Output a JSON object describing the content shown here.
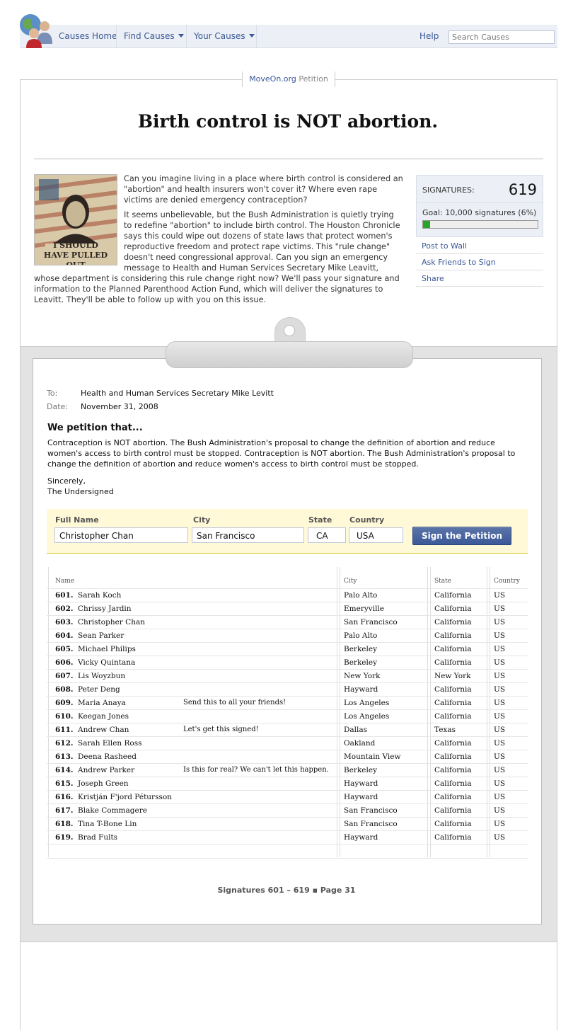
{
  "nav": {
    "causes_home": "Causes Home",
    "find_causes": "Find Causes",
    "your_causes": "Your Causes",
    "help": "Help",
    "search_placeholder": "Search Causes"
  },
  "petition": {
    "org": "MoveOn.org",
    "tab_suffix": "Petition",
    "title": "Birth control is NOT abortion.",
    "poster_text": "I SHOULD HAVE PULLED OUT",
    "paragraph1": "Can you imagine living in a place where birth control is considered an \"abortion\" and health insurers won't cover it? Where even rape victims are denied emergency contraception?",
    "paragraph2": "It seems unbelievable, but the Bush Administration is quietly trying to redefine \"abortion\" to include birth control. The Houston Chronicle says this could wipe out dozens of state laws that protect women's reproductive freedom and protect rape victims. This \"rule change\" doesn't need congressional approval. Can you sign an emergency message to Health and Human Services Secretary Mike Leavitt, whose department is considering this rule change right now? We'll pass your signature and information to the Planned Parenthood Action Fund, which will deliver the signatures to Leavitt. They'll be able to follow up with you on this issue."
  },
  "signatures": {
    "label": "SIGNATURES:",
    "count": "619",
    "goal_text": "Goal: 10,000 signatures (6%)",
    "progress": 0.06
  },
  "actions": {
    "post_to_wall": "Post to Wall",
    "ask_friends": "Ask Friends to Sign",
    "share": "Share"
  },
  "letter": {
    "to_label": "To:",
    "to": "Health and Human Services Secretary Mike Levitt",
    "date_label": "Date:",
    "date": "November 31, 2008",
    "heading": "We petition that...",
    "body": "Contraception is NOT abortion. The Bush Administration's proposal to change the definition of abortion and reduce women's access to birth control must be stopped. Contraception is NOT abortion. The Bush Administration's proposal to change the definition of abortion and reduce women's access to birth control must be stopped.",
    "closing1": "Sincerely,",
    "closing2": "The Undersigned"
  },
  "form": {
    "full_name_label": "Full Name",
    "city_label": "City",
    "state_label": "State",
    "country_label": "Country",
    "full_name": "Christopher Chan",
    "city": "San Francisco",
    "state": "CA",
    "country": "USA",
    "submit": "Sign the Petition"
  },
  "table": {
    "headers": {
      "name": "Name",
      "city": "City",
      "state": "State",
      "country": "Country"
    },
    "rows": [
      {
        "num": "601.",
        "name": "Sarah Koch",
        "comment": "",
        "city": "Palo Alto",
        "state": "California",
        "country": "US"
      },
      {
        "num": "602.",
        "name": "Chrissy Jardin",
        "comment": "",
        "city": "Emeryville",
        "state": "California",
        "country": "US"
      },
      {
        "num": "603.",
        "name": "Christopher Chan",
        "comment": "",
        "city": "San Francisco",
        "state": "California",
        "country": "US"
      },
      {
        "num": "604.",
        "name": "Sean Parker",
        "comment": "",
        "city": "Palo Alto",
        "state": "California",
        "country": "US"
      },
      {
        "num": "605.",
        "name": "Michael Philips",
        "comment": "",
        "city": "Berkeley",
        "state": "California",
        "country": "US"
      },
      {
        "num": "606.",
        "name": "Vicky Quintana",
        "comment": "",
        "city": "Berkeley",
        "state": "California",
        "country": "US"
      },
      {
        "num": "607.",
        "name": "Lis Woyzbun",
        "comment": "",
        "city": "New York",
        "state": "New York",
        "country": "US"
      },
      {
        "num": "608.",
        "name": "Peter Deng",
        "comment": "",
        "city": "Hayward",
        "state": "California",
        "country": "US"
      },
      {
        "num": "609.",
        "name": "Maria Anaya",
        "comment": "Send this to all your friends!",
        "city": "Los Angeles",
        "state": "California",
        "country": "US"
      },
      {
        "num": "610.",
        "name": "Keegan Jones",
        "comment": "",
        "city": "Los Angeles",
        "state": "California",
        "country": "US"
      },
      {
        "num": "611.",
        "name": "Andrew Chan",
        "comment": "Let's get this signed!",
        "city": "Dallas",
        "state": "Texas",
        "country": "US"
      },
      {
        "num": "612.",
        "name": "Sarah Ellen Ross",
        "comment": "",
        "city": "Oakland",
        "state": "California",
        "country": "US"
      },
      {
        "num": "613.",
        "name": "Deena Rasheed",
        "comment": "",
        "city": "Mountain View",
        "state": "California",
        "country": "US"
      },
      {
        "num": "614.",
        "name": "Andrew Parker",
        "comment": "Is this for real? We can't let this happen.",
        "city": "Berkeley",
        "state": "California",
        "country": "US"
      },
      {
        "num": "615.",
        "name": "Joseph Green",
        "comment": "",
        "city": "Hayward",
        "state": "California",
        "country": "US"
      },
      {
        "num": "616.",
        "name": "Kristján F'jord Pétursson",
        "comment": "",
        "city": "Hayward",
        "state": "California",
        "country": "US"
      },
      {
        "num": "617.",
        "name": "Blake Commagere",
        "comment": "",
        "city": "San Francisco",
        "state": "California",
        "country": "US"
      },
      {
        "num": "618.",
        "name": "Tina T-Bone Lin",
        "comment": "",
        "city": "San Francisco",
        "state": "California",
        "country": "US"
      },
      {
        "num": "619.",
        "name": "Brad Fults",
        "comment": "",
        "city": "Hayward",
        "state": "California",
        "country": "US"
      }
    ]
  },
  "pager": "Signatures 601 – 619 ▪ Page 31",
  "colors": {
    "link": "#3b5998",
    "progress": "#28a528",
    "form_bg": "#fff9d7"
  }
}
